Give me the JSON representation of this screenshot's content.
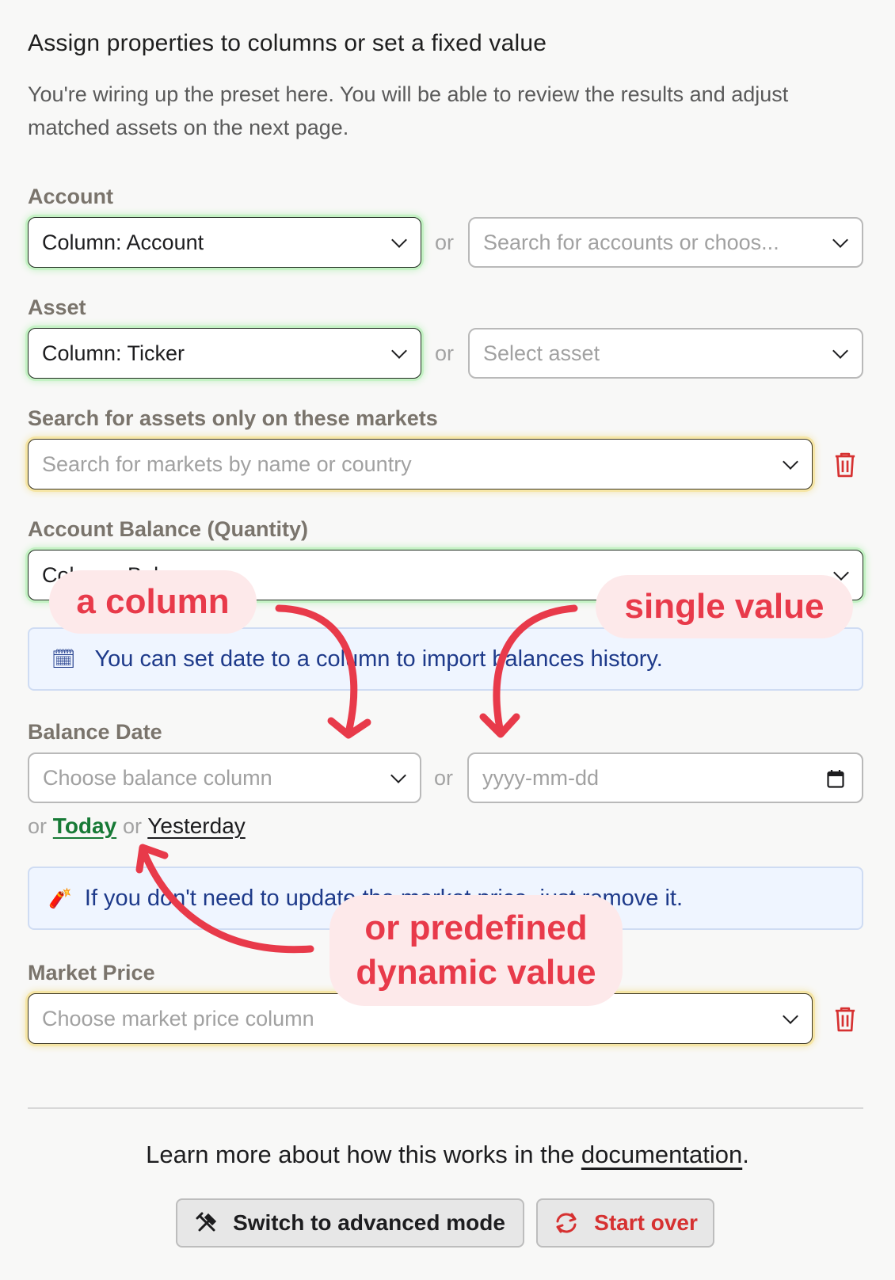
{
  "header": {
    "title": "Assign properties to columns or set a fixed value",
    "intro": "You're wiring up the preset here. You will be able to review the results and adjust matched assets on the next page."
  },
  "or_text": "or",
  "account": {
    "label": "Account",
    "column_value": "Column: Account",
    "fixed_placeholder": "Search for accounts or choos..."
  },
  "asset": {
    "label": "Asset",
    "column_value": "Column: Ticker",
    "fixed_placeholder": "Select asset"
  },
  "markets": {
    "label": "Search for assets only on these markets",
    "placeholder": "Search for markets by name or country"
  },
  "balance": {
    "label": "Account Balance (Quantity)",
    "column_value": "Column: Balance"
  },
  "info_date": {
    "icon": "calendar-emoji",
    "text": "You can set date to a column to import balances history."
  },
  "balance_date": {
    "label": "Balance Date",
    "column_placeholder": "Choose balance column",
    "date_placeholder": "yyyy-mm-dd",
    "quick_prefix": "or",
    "today": "Today",
    "quick_mid": "or",
    "yesterday": "Yesterday"
  },
  "info_price": {
    "icon": "dynamite-emoji",
    "text": "If you don't need to update the market price, just remove it."
  },
  "market_price": {
    "label": "Market Price",
    "placeholder": "Choose market price column"
  },
  "annotations": {
    "a_column": "a column",
    "single_value": "single value",
    "predefined_line1": "or predefined",
    "predefined_line2": "dynamic value",
    "color": "#e83a4a"
  },
  "footer": {
    "learn_prefix": "Learn more about how this works in the ",
    "learn_link": "documentation",
    "learn_suffix": ".",
    "advanced_button": "Switch to advanced mode",
    "start_over_button": "Start over"
  }
}
